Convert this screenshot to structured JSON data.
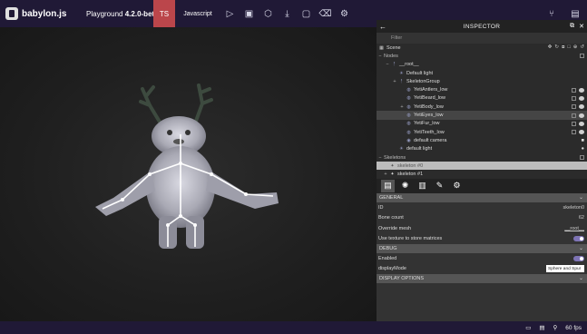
{
  "header": {
    "logo_text": "babylon.js",
    "title_prefix": "Playground",
    "version": "4.2.0-beta.6",
    "tab_ts": "TS",
    "tab_js": "Javascript",
    "icons": [
      "play-icon",
      "save-icon",
      "inspector-icon",
      "download-icon",
      "new-icon",
      "clear-icon",
      "settings-icon"
    ],
    "right_icons": [
      "examples-icon",
      "fullscreen-icon"
    ]
  },
  "inspector": {
    "title": "INSPECTOR",
    "filter_placeholder": "Filter",
    "scene_label": "Scene",
    "nodes_label": "Nodes",
    "tree": [
      {
        "label": "__root__",
        "depth": 1,
        "sym": "−"
      },
      {
        "label": "Default light",
        "depth": 2,
        "sym": ""
      },
      {
        "label": "SkeletonGroup",
        "depth": 2,
        "sym": "+"
      },
      {
        "label": "YetiAntlers_low",
        "depth": 3,
        "sym": ""
      },
      {
        "label": "YetiBeard_low",
        "depth": 3,
        "sym": ""
      },
      {
        "label": "YetiBody_low",
        "depth": 3,
        "sym": "+"
      },
      {
        "label": "YetiEyes_low",
        "depth": 3,
        "sym": ""
      },
      {
        "label": "YetiFur_low",
        "depth": 3,
        "sym": ""
      },
      {
        "label": "YetiTeeth_low",
        "depth": 3,
        "sym": ""
      },
      {
        "label": "default camera",
        "depth": 3,
        "sym": ""
      },
      {
        "label": "default light",
        "depth": 2,
        "sym": ""
      }
    ],
    "skeletons_label": "Skeletons",
    "skeletons": [
      "skeleton #0",
      "skeleton #1"
    ],
    "tabs": [
      "properties-tab",
      "debug-tab",
      "statistics-tab",
      "tools-tab",
      "settings-tab"
    ],
    "general": {
      "header": "GENERAL",
      "id_label": "ID",
      "id_value": "skeleton0",
      "bone_label": "Bone count",
      "bone_value": "62",
      "override_label": "Override mesh",
      "override_value": "__root__",
      "texture_label": "Use texture to store matrices"
    },
    "debug": {
      "header": "DEBUG",
      "enabled_label": "Enabled",
      "display_label": "displayMode",
      "display_value": "Sphere and Spur"
    },
    "display_options_header": "DISPLAY OPTIONS"
  },
  "footer": {
    "fps": "60 fps"
  },
  "colors": {
    "topbar": "#201936",
    "ts_tab": "#bb464b",
    "toggle": "#7e74b5"
  }
}
